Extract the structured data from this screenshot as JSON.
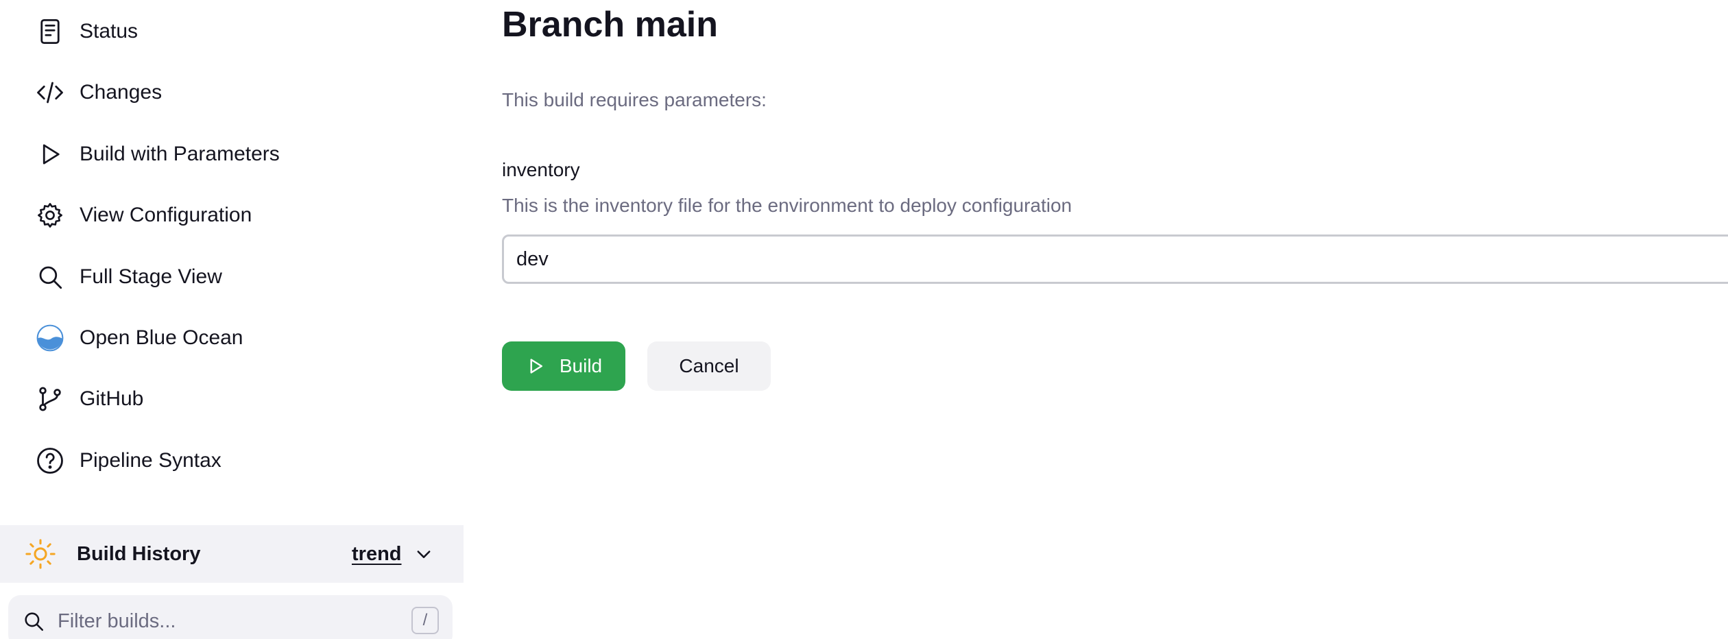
{
  "sidebar": {
    "items": [
      {
        "label": "Status",
        "icon": "document-icon"
      },
      {
        "label": "Changes",
        "icon": "code-icon"
      },
      {
        "label": "Build with Parameters",
        "icon": "play-icon"
      },
      {
        "label": "View Configuration",
        "icon": "gear-icon"
      },
      {
        "label": "Full Stage View",
        "icon": "search-icon"
      },
      {
        "label": "Open Blue Ocean",
        "icon": "blue-ocean-icon"
      },
      {
        "label": "GitHub",
        "icon": "git-branch-icon"
      },
      {
        "label": "Pipeline Syntax",
        "icon": "help-icon"
      }
    ]
  },
  "build_history": {
    "title": "Build History",
    "trend_label": "trend",
    "filter_placeholder": "Filter builds...",
    "filter_shortcut": "/"
  },
  "main": {
    "title": "Branch main",
    "requires_text": "This build requires parameters:",
    "parameter": {
      "name": "inventory",
      "description": "This is the inventory file for the environment to deploy configuration",
      "value": "dev"
    },
    "build_label": "Build",
    "cancel_label": "Cancel"
  },
  "colors": {
    "build_button": "#2ea44f",
    "history_bar": "#f2f2f6",
    "sun_icon": "#f5a623",
    "blue_ocean": "#4a90d9"
  }
}
